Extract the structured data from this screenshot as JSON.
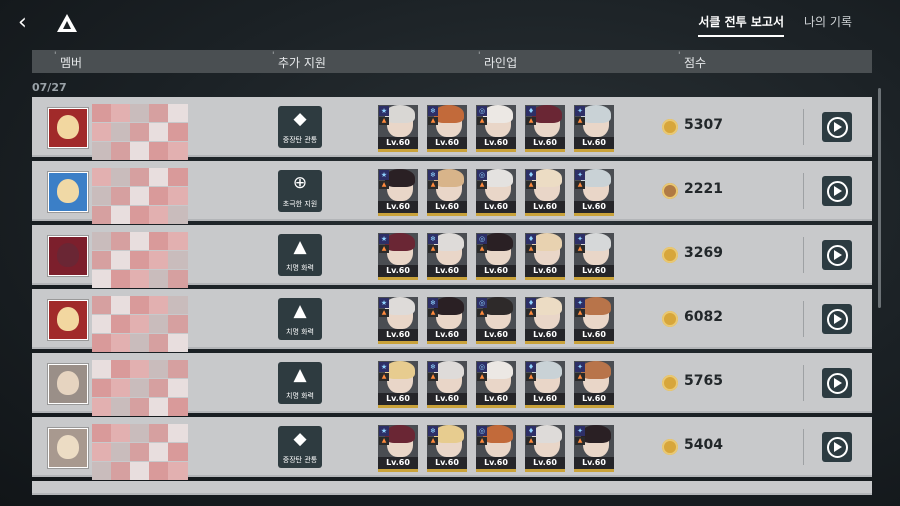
{
  "topbar": {
    "back_icon": "chevron-left-icon",
    "logo_icon": "triangle-logo-icon",
    "tabs": [
      {
        "label": "서클 전투 보고서",
        "active": true
      },
      {
        "label": "나의 기록",
        "active": false
      }
    ]
  },
  "table": {
    "headers": {
      "member": "멤버",
      "support": "추가 지원",
      "lineup": "라인업",
      "score": "점수"
    },
    "date": "07/27",
    "rows": [
      {
        "support_label": "중장탄 관통",
        "support_icon": "armor-pierce-icon",
        "score": "5307",
        "medal": "gold",
        "lineup": [
          {
            "level": "Lv.60",
            "hair": "#d9d7d4"
          },
          {
            "level": "Lv.60",
            "hair": "#c26a3a"
          },
          {
            "level": "Lv.60",
            "hair": "#ece8e4"
          },
          {
            "level": "Lv.60",
            "hair": "#6a2634"
          },
          {
            "level": "Lv.60",
            "hair": "#c9d2d6"
          }
        ]
      },
      {
        "support_label": "초극한 지원",
        "support_icon": "crosshair-upgrade-icon",
        "score": "2221",
        "medal": "bronze",
        "lineup": [
          {
            "level": "Lv.60",
            "hair": "#2a2024"
          },
          {
            "level": "Lv.60",
            "hair": "#d8b48a"
          },
          {
            "level": "Lv.60",
            "hair": "#e4e2e0"
          },
          {
            "level": "Lv.60",
            "hair": "#ecdcc4"
          },
          {
            "level": "Lv.60",
            "hair": "#c9d2d6"
          }
        ]
      },
      {
        "support_label": "치명 화력",
        "support_icon": "critical-fire-icon",
        "score": "3269",
        "medal": "gold",
        "lineup": [
          {
            "level": "Lv.60",
            "hair": "#6a2634"
          },
          {
            "level": "Lv.60",
            "hair": "#dedbd9"
          },
          {
            "level": "Lv.60",
            "hair": "#2a2024"
          },
          {
            "level": "Lv.60",
            "hair": "#e8d2b0"
          },
          {
            "level": "Lv.60",
            "hair": "#d6d8d9"
          }
        ]
      },
      {
        "support_label": "치명 화력",
        "support_icon": "critical-fire-icon",
        "score": "6082",
        "medal": "gold",
        "lineup": [
          {
            "level": "Lv.60",
            "hair": "#dedbd9"
          },
          {
            "level": "Lv.60",
            "hair": "#2a2024"
          },
          {
            "level": "Lv.60",
            "hair": "#2e2a2a"
          },
          {
            "level": "Lv.60",
            "hair": "#ecdcc4"
          },
          {
            "level": "Lv.60",
            "hair": "#b8744a"
          }
        ]
      },
      {
        "support_label": "치명 화력",
        "support_icon": "critical-fire-icon",
        "score": "5765",
        "medal": "gold",
        "lineup": [
          {
            "level": "Lv.60",
            "hair": "#e7cc8f"
          },
          {
            "level": "Lv.60",
            "hair": "#dedbd9"
          },
          {
            "level": "Lv.60",
            "hair": "#ece8e4"
          },
          {
            "level": "Lv.60",
            "hair": "#c9d2d6"
          },
          {
            "level": "Lv.60",
            "hair": "#b8744a"
          }
        ]
      },
      {
        "support_label": "중장탄 관통",
        "support_icon": "armor-pierce-icon",
        "score": "5404",
        "medal": "gold",
        "lineup": [
          {
            "level": "Lv.60",
            "hair": "#6a2634"
          },
          {
            "level": "Lv.60",
            "hair": "#e7cc8f"
          },
          {
            "level": "Lv.60",
            "hair": "#c26a3a"
          },
          {
            "level": "Lv.60",
            "hair": "#dedbd9"
          },
          {
            "level": "Lv.60",
            "hair": "#2a2024"
          }
        ]
      }
    ]
  },
  "colors": {
    "accent": "#2c3b41",
    "gold": "#d7a63b",
    "row_bg": "#c8c9cb"
  }
}
